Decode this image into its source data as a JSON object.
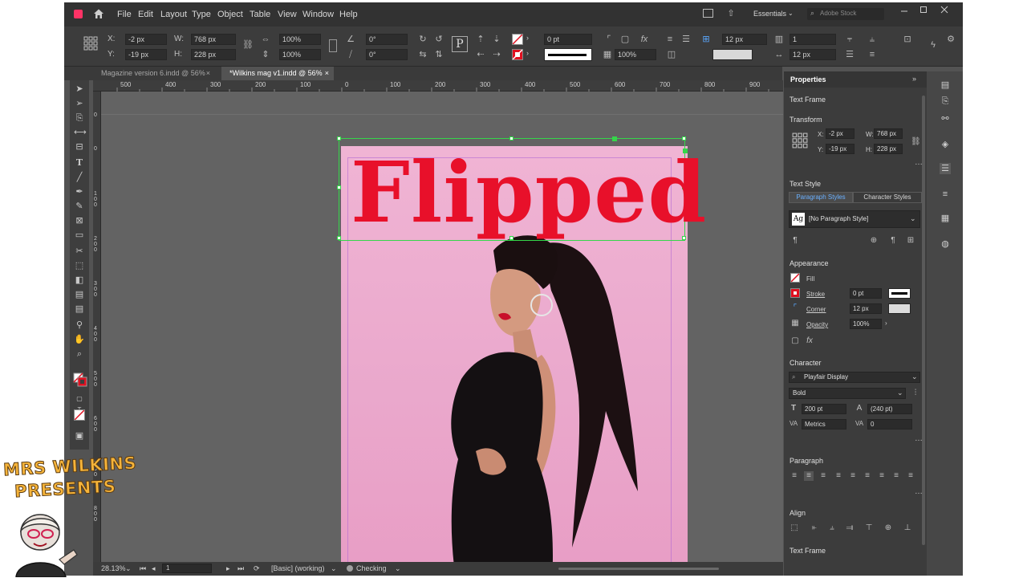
{
  "menu": [
    "File",
    "Edit",
    "Layout",
    "Type",
    "Object",
    "Table",
    "View",
    "Window",
    "Help"
  ],
  "workspace": "Essentials",
  "search_placeholder": "Adobe Stock",
  "control": {
    "x_label": "X:",
    "x": "-2 px",
    "y_label": "Y:",
    "y": "-19 px",
    "w_label": "W:",
    "w": "768 px",
    "h_label": "H:",
    "h": "228 px",
    "scale_x": "100%",
    "scale_y": "100%",
    "angle": "0°",
    "shear": "0°",
    "stroke_weight": "0 pt",
    "opacity": "100%",
    "gutter": "12 px",
    "columns": "1",
    "col_width": "12 px"
  },
  "tabs": [
    {
      "label": "Magazine version 6.indd @ 56%",
      "close": "×"
    },
    {
      "label": "*Wilkins mag v1.indd @ 56%",
      "close": "×"
    }
  ],
  "ruler_h": [
    "500",
    "400",
    "300",
    "200",
    "100",
    "0",
    "100",
    "200",
    "300",
    "400",
    "500",
    "600",
    "700",
    "800",
    "900"
  ],
  "ruler_v": [
    "0",
    "0",
    "1\n0\n0",
    "2\n0\n0",
    "3\n0\n0",
    "4\n0\n0",
    "5\n0\n0",
    "6\n0\n0",
    "7\n0\n0",
    "8\n0\n0"
  ],
  "page": {
    "headline": "Flipped"
  },
  "status": {
    "zoom": "28.13%",
    "page": "1",
    "preflight_profile": "[Basic] (working)",
    "preflight": "Checking"
  },
  "properties": {
    "title": "Properties",
    "object_type": "Text Frame",
    "transform_title": "Transform",
    "x_label": "X:",
    "x": "-2 px",
    "y_label": "Y:",
    "y": "-19 px",
    "w_label": "W:",
    "w": "768 px",
    "h_label": "H:",
    "h": "228 px",
    "text_style_title": "Text Style",
    "paragraph_styles_tab": "Paragraph Styles",
    "character_styles_tab": "Character Styles",
    "paragraph_style": "[No Paragraph Style]",
    "appearance_title": "Appearance",
    "fill_label": "Fill",
    "stroke_label": "Stroke",
    "stroke_value": "0 pt",
    "corner_label": "Corner",
    "corner_value": "12 px",
    "opacity_label": "Opacity",
    "opacity_value": "100%",
    "character_title": "Character",
    "font_family": "Playfair Display",
    "font_style": "Bold",
    "font_size": "200 pt",
    "leading": "(240 pt)",
    "kerning": "Metrics",
    "tracking": "0",
    "paragraph_title": "Paragraph",
    "align_title": "Align",
    "text_frame_title": "Text Frame"
  },
  "brand": {
    "line1": "MRS WILKINS",
    "line2": "PRESENTS"
  },
  "colors": {
    "headline": "#e8102a",
    "page_pink": "#f0b4d4",
    "selection": "#35d64a",
    "brand_text": "#f6b43a"
  }
}
